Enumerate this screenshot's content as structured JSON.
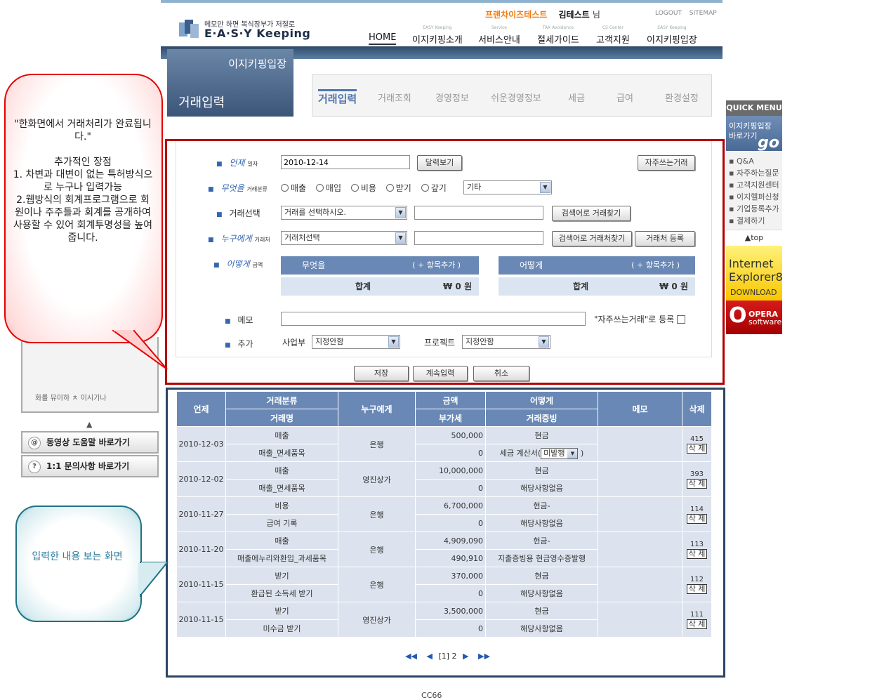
{
  "header": {
    "logo_tagline": "메모만 하면 복식장부가 저절로",
    "logo_name": "E·A·S·Y Keeping",
    "franchise": "프랜차이즈테스트",
    "user_name": "김테스트",
    "user_suffix": "님",
    "logout": "LOGOUT",
    "sitemap": "SITEMAP",
    "nav": [
      {
        "sub": "",
        "label": "HOME"
      },
      {
        "sub": "EASY Keeping",
        "label": "이지키핑소개"
      },
      {
        "sub": "Service",
        "label": "서비스안내"
      },
      {
        "sub": "TAX Avoidance",
        "label": "절세가이드"
      },
      {
        "sub": "CS Center",
        "label": "고객지원"
      },
      {
        "sub": "EASY Keeping",
        "label": "이지키핑입장"
      }
    ]
  },
  "section": {
    "top_label": "이지키핑입장",
    "title": "거래입력",
    "tabs": [
      "거래입력",
      "거래조회",
      "경영정보",
      "쉬운경영정보",
      "세금",
      "급여",
      "환경설정"
    ]
  },
  "form": {
    "date_label": "언제",
    "date_small": "일자",
    "date_value": "2010-12-14",
    "calendar_btn": "달력보기",
    "favorite_btn": "자주쓰는거래",
    "what_label": "무엇을",
    "what_small": "거래분류",
    "radio_options": [
      "매출",
      "매입",
      "비용",
      "받기",
      "갚기"
    ],
    "other_select": "기타",
    "deal_label": "거래선택",
    "deal_select": "거래를 선택하시오.",
    "deal_search_btn": "검색어로 거래찾기",
    "who_label": "누구에게",
    "who_small": "거래처",
    "who_select": "거래처선택",
    "who_search_btn": "검색어로 거래처찾기",
    "who_register_btn": "거래처 등록",
    "how_label": "어떻게",
    "how_small": "금액",
    "left_head": "무엇을",
    "right_head": "어떻게",
    "add_item": "( + 항목추가 )",
    "sum_label": "합계",
    "sum_value": "₩ 0 원",
    "memo_label": "메모",
    "memo_favorite": "\"자주쓰는거래\"로 등록",
    "extra_label": "추가",
    "dept_label": "사업부",
    "dept_select": "지정안함",
    "project_label": "프로젝트",
    "project_select": "지정안함",
    "save_btn": "저장",
    "continue_btn": "계속입력",
    "cancel_btn": "취소"
  },
  "grid": {
    "headers": {
      "date": "언제",
      "category": "거래분류",
      "item": "거래명",
      "who": "누구에게",
      "amount": "금액",
      "vat": "부가세",
      "how": "어떻게",
      "proof": "거래증빙",
      "memo": "메모",
      "delete": "삭제"
    },
    "rows": [
      {
        "date": "2010-12-03",
        "category": "매출",
        "item": "매출_면세품목",
        "who": "은행",
        "amount": "500,000",
        "vat": "0",
        "how": "현금",
        "proof": "세금 계산서(",
        "proof_select": "미발행",
        "proof_end": ")",
        "id": "415"
      },
      {
        "date": "2010-12-02",
        "category": "매출",
        "item": "매출_면세품목",
        "who": "영진상가",
        "amount": "10,000,000",
        "vat": "0",
        "how": "현금",
        "proof": "해당사항없음",
        "proof_select": "",
        "proof_end": "",
        "id": "393"
      },
      {
        "date": "2010-11-27",
        "category": "비용",
        "item": "급여 기록",
        "who": "은행",
        "amount": "6,700,000",
        "vat": "0",
        "how": "현금-",
        "proof": "해당사항없음",
        "proof_select": "",
        "proof_end": "",
        "id": "114"
      },
      {
        "date": "2010-11-20",
        "category": "매출",
        "item": "매출에누리와환입_과세품목",
        "who": "은행",
        "amount": "4,909,090",
        "vat": "490,910",
        "how": "현금-",
        "proof": "지출증빙용 현금영수증발행",
        "proof_select": "",
        "proof_end": "",
        "id": "113"
      },
      {
        "date": "2010-11-15",
        "category": "받기",
        "item": "환급된 소득세 받기",
        "who": "은행",
        "amount": "370,000",
        "vat": "0",
        "how": "현금",
        "proof": "해당사항없음",
        "proof_select": "",
        "proof_end": "",
        "id": "112"
      },
      {
        "date": "2010-11-15",
        "category": "받기",
        "item": "미수금 받기",
        "who": "영진상가",
        "amount": "3,500,000",
        "vat": "0",
        "how": "현금",
        "proof": "해당사항없음",
        "proof_select": "",
        "proof_end": "",
        "id": "111"
      }
    ],
    "delete_label": "삭 제",
    "pager_current": "[1]",
    "pager_next": "2"
  },
  "left": {
    "bubble1": "\"한화면에서 거래처리가 완료됩니다.\"\n\n추가적인 장점\n1. 차변과 대변이 없는 특허방식으로 누구나 입력가능\n2.웹방식의 회계프로그램으로 회원이나 주주들과 회계를 공개하여 사용할 수 있어 회계투명성을 높여줍니다.",
    "panel_text": "화를 뮤이하 ㅊ 이시기나",
    "video_help": "동영상 도움말 바로가기",
    "qna": "1:1 문의사항 바로가기",
    "bubble2": "입력한 내용 보는 화면"
  },
  "quick": {
    "title": "QUICK MENU",
    "go_text": "이지키핑입장 바로가기",
    "go": "go",
    "links": [
      "Q&A",
      "자주하는질문",
      "고객지원센터",
      "이지헬퍼신청",
      "기업등록추가",
      "결제하기"
    ],
    "top": "▲top",
    "ie_text": "Internet Explorer8",
    "ie_download": "DOWNLOAD",
    "opera": "OPERA",
    "opera_sub": "software"
  },
  "footer": "CC66"
}
